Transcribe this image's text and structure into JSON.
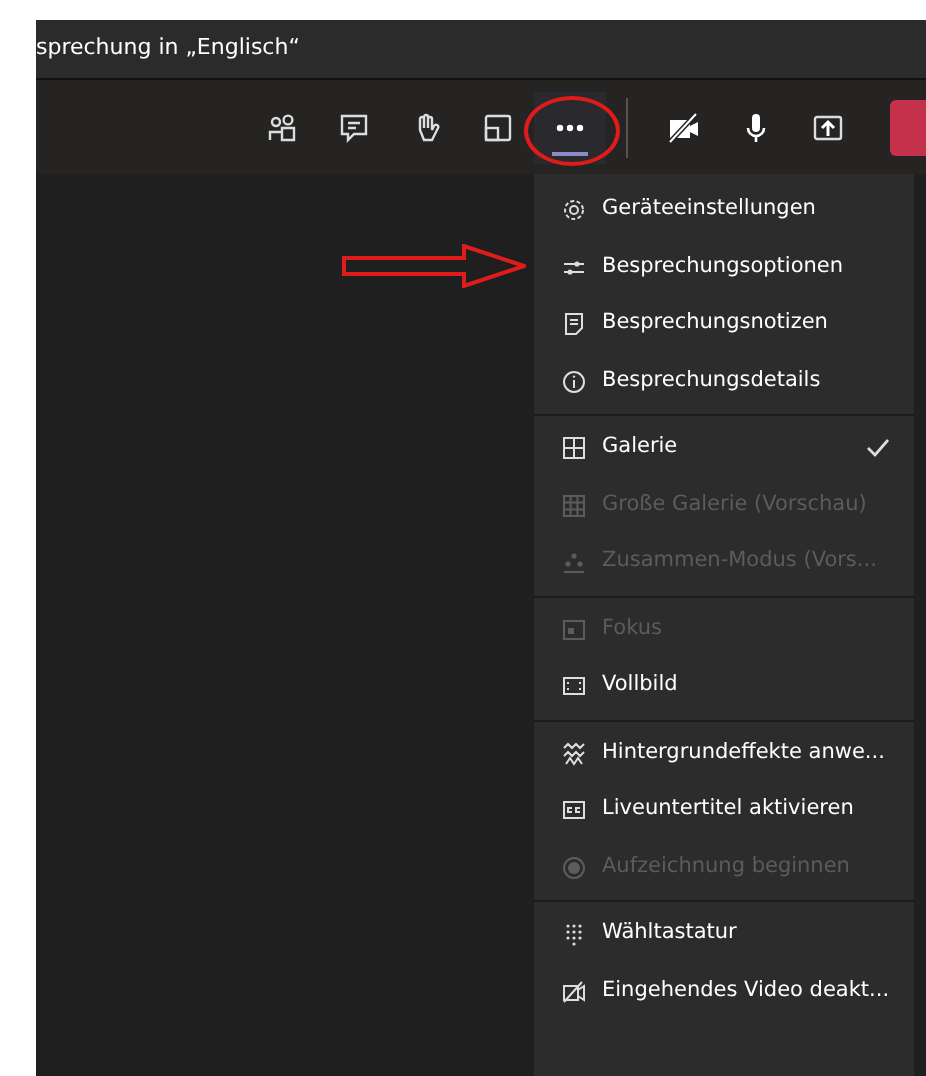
{
  "window": {
    "title": "sprechung in „Englisch“"
  },
  "toolbar": [
    {
      "kind": "people",
      "selected": false
    },
    {
      "kind": "chat",
      "selected": false
    },
    {
      "kind": "hand",
      "selected": false
    },
    {
      "kind": "tray",
      "selected": false
    },
    {
      "kind": "more",
      "selected": true
    }
  ],
  "call_controls": [
    {
      "kind": "camera-off"
    },
    {
      "kind": "mic"
    },
    {
      "kind": "share"
    },
    {
      "kind": "hangup"
    }
  ],
  "menu": {
    "groups": [
      [
        {
          "kind": "gear",
          "label": "Geräteeinstellungen",
          "disabled": false,
          "checked": false
        },
        {
          "kind": "sliders",
          "label": "Besprechungsoptionen",
          "disabled": false,
          "checked": false
        },
        {
          "kind": "notes",
          "label": "Besprechungsnotizen",
          "disabled": false,
          "checked": false
        },
        {
          "kind": "info",
          "label": "Besprechungsdetails",
          "disabled": false,
          "checked": false
        }
      ],
      [
        {
          "kind": "grid4",
          "label": "Galerie",
          "disabled": false,
          "checked": true
        },
        {
          "kind": "grid9",
          "label": "Große Galerie (Vorschau)",
          "disabled": true,
          "checked": false
        },
        {
          "kind": "group",
          "label": "Zusammen-Modus (Vors...",
          "disabled": true,
          "checked": false
        }
      ],
      [
        {
          "kind": "focus",
          "label": "Fokus",
          "disabled": true,
          "checked": false
        },
        {
          "kind": "fullscreen",
          "label": "Vollbild",
          "disabled": false,
          "checked": false
        }
      ],
      [
        {
          "kind": "effects",
          "label": "Hintergrundeffekte anwe...",
          "disabled": false,
          "checked": false
        },
        {
          "kind": "cc",
          "label": "Liveuntertitel aktivieren",
          "disabled": false,
          "checked": false
        },
        {
          "kind": "record",
          "label": "Aufzeichnung beginnen",
          "disabled": true,
          "checked": false
        }
      ],
      [
        {
          "kind": "dialpad",
          "label": "Wähltastatur",
          "disabled": false,
          "checked": false
        },
        {
          "kind": "video-off",
          "label": "Eingehendes Video deakt...",
          "disabled": false,
          "checked": false
        }
      ]
    ]
  }
}
